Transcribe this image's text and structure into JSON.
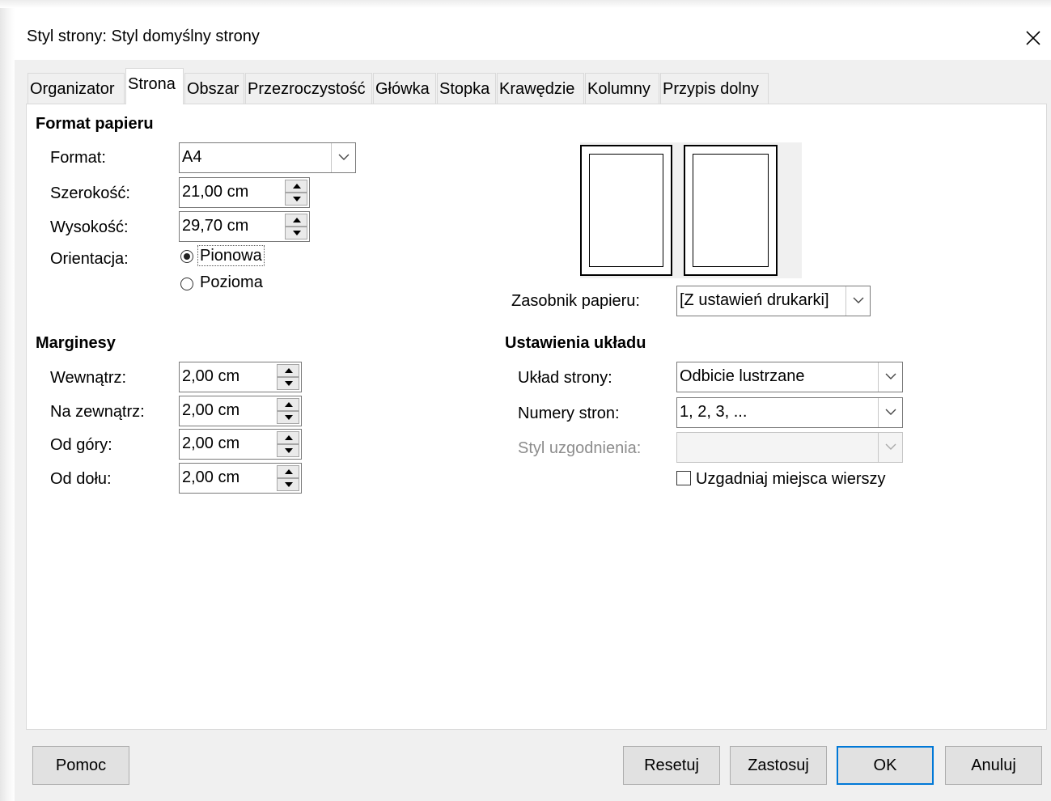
{
  "dialog": {
    "title": "Styl strony: Styl domyślny strony"
  },
  "tabs": [
    {
      "label": "Organizator"
    },
    {
      "label": "Strona"
    },
    {
      "label": "Obszar"
    },
    {
      "label": "Przezroczystość"
    },
    {
      "label": "Główka"
    },
    {
      "label": "Stopka"
    },
    {
      "label": "Krawędzie"
    },
    {
      "label": "Kolumny"
    },
    {
      "label": "Przypis dolny"
    }
  ],
  "active_tab": "Strona",
  "paper_format": {
    "heading": "Format papieru",
    "format_label": "Format:",
    "format_value": "A4",
    "width_label": "Szerokość:",
    "width_value": "21,00 cm",
    "height_label": "Wysokość:",
    "height_value": "29,70 cm",
    "orientation_label": "Orientacja:",
    "portrait_label": "Pionowa",
    "landscape_label": "Pozioma",
    "selected_orientation": "Pionowa",
    "paper_tray_label": "Zasobnik papieru:",
    "paper_tray_value": "[Z ustawień drukarki]"
  },
  "margins": {
    "heading": "Marginesy",
    "inner_label": "Wewnątrz:",
    "inner_value": "2,00 cm",
    "outer_label": "Na zewnątrz:",
    "outer_value": "2,00 cm",
    "top_label": "Od góry:",
    "top_value": "2,00 cm",
    "bottom_label": "Od dołu:",
    "bottom_value": "2,00 cm"
  },
  "layout": {
    "heading": "Ustawienia układu",
    "page_layout_label": "Układ strony:",
    "page_layout_value": "Odbicie lustrzane",
    "page_numbers_label": "Numery stron:",
    "page_numbers_value": "1, 2, 3, ...",
    "reference_style_label": "Styl uzgodnienia:",
    "reference_style_value": "",
    "register_true_label": "Uzgadniaj miejsca wierszy",
    "register_true_checked": false
  },
  "buttons": {
    "help": "Pomoc",
    "reset": "Resetuj",
    "apply": "Zastosuj",
    "ok": "OK",
    "cancel": "Anuluj"
  },
  "colors": {
    "default_button_border": "#0078d7",
    "panel_bg": "#ffffff",
    "dialog_bg": "#f0f0f0"
  }
}
